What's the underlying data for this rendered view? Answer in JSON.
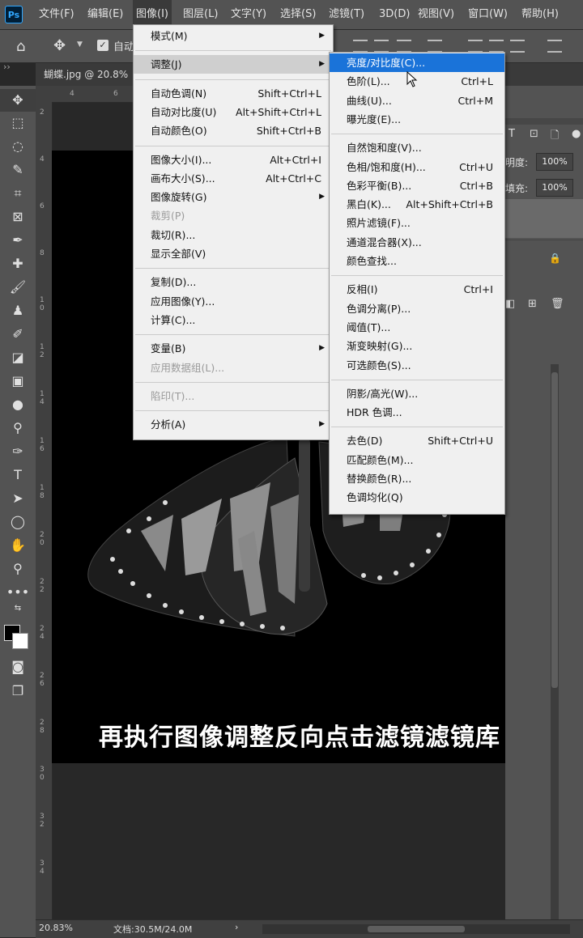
{
  "app": {
    "logo": "Ps"
  },
  "menubar": {
    "items": [
      "文件(F)",
      "编辑(E)",
      "图像(I)",
      "图层(L)",
      "文字(Y)",
      "选择(S)",
      "滤镜(T)",
      "3D(D)",
      "视图(V)",
      "窗口(W)",
      "帮助(H)"
    ],
    "active_index": 2
  },
  "options": {
    "auto_label": "自动"
  },
  "tab": {
    "title": "蝴蝶.jpg @ 20.8%"
  },
  "ruler": {
    "top": [
      "4",
      "6"
    ],
    "left": [
      "2",
      "4",
      "6",
      "8",
      "1\n0",
      "1\n2",
      "1\n4",
      "1\n6",
      "1\n8",
      "2\n0",
      "2\n2",
      "2\n4",
      "2\n6",
      "2\n8",
      "3\n0",
      "3\n2",
      "3\n4"
    ]
  },
  "image_menu": {
    "items": [
      {
        "label": "模式(M)",
        "shortcut": "",
        "submenu": true,
        "disabled": false
      },
      {
        "sep": true
      },
      {
        "label": "调整(J)",
        "shortcut": "",
        "submenu": true,
        "disabled": false,
        "highlighted": true
      },
      {
        "sep": true
      },
      {
        "label": "自动色调(N)",
        "shortcut": "Shift+Ctrl+L",
        "disabled": false
      },
      {
        "label": "自动对比度(U)",
        "shortcut": "Alt+Shift+Ctrl+L",
        "disabled": false
      },
      {
        "label": "自动颜色(O)",
        "shortcut": "Shift+Ctrl+B",
        "disabled": false
      },
      {
        "sep": true
      },
      {
        "label": "图像大小(I)...",
        "shortcut": "Alt+Ctrl+I",
        "disabled": false
      },
      {
        "label": "画布大小(S)...",
        "shortcut": "Alt+Ctrl+C",
        "disabled": false
      },
      {
        "label": "图像旋转(G)",
        "shortcut": "",
        "submenu": true,
        "disabled": false
      },
      {
        "label": "裁剪(P)",
        "shortcut": "",
        "disabled": true
      },
      {
        "label": "裁切(R)...",
        "shortcut": "",
        "disabled": false
      },
      {
        "label": "显示全部(V)",
        "shortcut": "",
        "disabled": false
      },
      {
        "sep": true
      },
      {
        "label": "复制(D)...",
        "shortcut": "",
        "disabled": false
      },
      {
        "label": "应用图像(Y)...",
        "shortcut": "",
        "disabled": false
      },
      {
        "label": "计算(C)...",
        "shortcut": "",
        "disabled": false
      },
      {
        "sep": true
      },
      {
        "label": "变量(B)",
        "shortcut": "",
        "submenu": true,
        "disabled": false
      },
      {
        "label": "应用数据组(L)...",
        "shortcut": "",
        "disabled": true
      },
      {
        "sep": true
      },
      {
        "label": "陷印(T)...",
        "shortcut": "",
        "disabled": true
      },
      {
        "sep": true
      },
      {
        "label": "分析(A)",
        "shortcut": "",
        "submenu": true,
        "disabled": false
      }
    ]
  },
  "adjust_menu": {
    "items": [
      {
        "label": "亮度/对比度(C)...",
        "shortcut": "",
        "highlighted": true
      },
      {
        "label": "色阶(L)...",
        "shortcut": "Ctrl+L"
      },
      {
        "label": "曲线(U)...",
        "shortcut": "Ctrl+M"
      },
      {
        "label": "曝光度(E)...",
        "shortcut": ""
      },
      {
        "sep": true
      },
      {
        "label": "自然饱和度(V)...",
        "shortcut": ""
      },
      {
        "label": "色相/饱和度(H)...",
        "shortcut": "Ctrl+U"
      },
      {
        "label": "色彩平衡(B)...",
        "shortcut": "Ctrl+B"
      },
      {
        "label": "黑白(K)...",
        "shortcut": "Alt+Shift+Ctrl+B"
      },
      {
        "label": "照片滤镜(F)...",
        "shortcut": ""
      },
      {
        "label": "通道混合器(X)...",
        "shortcut": ""
      },
      {
        "label": "颜色查找...",
        "shortcut": ""
      },
      {
        "sep": true
      },
      {
        "label": "反相(I)",
        "shortcut": "Ctrl+I"
      },
      {
        "label": "色调分离(P)...",
        "shortcut": ""
      },
      {
        "label": "阈值(T)...",
        "shortcut": ""
      },
      {
        "label": "渐变映射(G)...",
        "shortcut": ""
      },
      {
        "label": "可选颜色(S)...",
        "shortcut": ""
      },
      {
        "sep": true
      },
      {
        "label": "阴影/高光(W)...",
        "shortcut": ""
      },
      {
        "label": "HDR 色调...",
        "shortcut": ""
      },
      {
        "sep": true
      },
      {
        "label": "去色(D)",
        "shortcut": "Shift+Ctrl+U"
      },
      {
        "label": "匹配颜色(M)...",
        "shortcut": ""
      },
      {
        "label": "替换颜色(R)...",
        "shortcut": ""
      },
      {
        "label": "色调均化(Q)",
        "shortcut": ""
      }
    ]
  },
  "layers_panel": {
    "opacity_label": "明度:",
    "opacity_value": "100%",
    "fill_label": "填充:",
    "fill_value": "100%"
  },
  "canvas": {
    "subtitle": "再执行图像调整反向点击滤镜滤镜库"
  },
  "status": {
    "zoom": "20.83%",
    "doc": "文档:30.5M/24.0M",
    "arrow": "›"
  },
  "colors": {
    "menu_highlight": "#1a73d9",
    "ui_gray": "#535353"
  },
  "icons": {
    "home": "home-icon",
    "move": "move-icon"
  }
}
